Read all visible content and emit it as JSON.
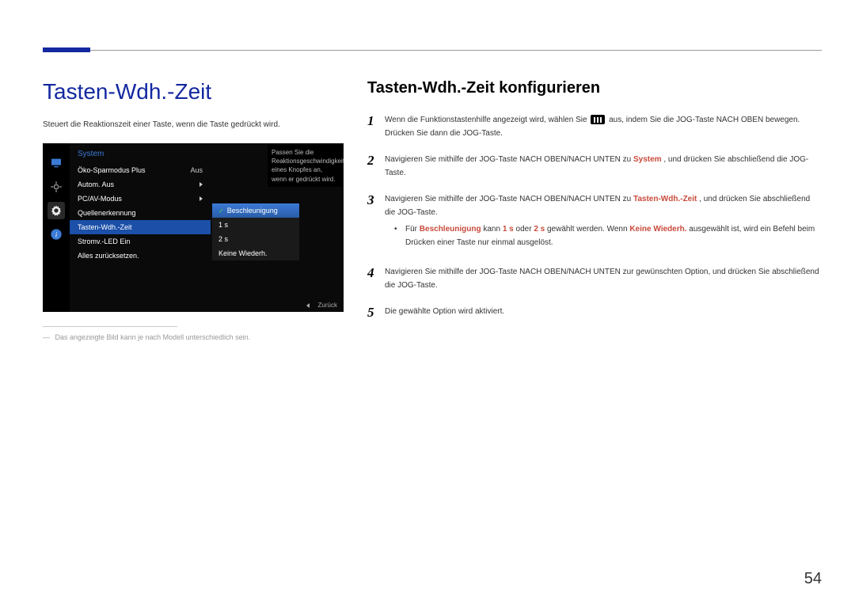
{
  "page_number": "54",
  "main_title": "Tasten-Wdh.-Zeit",
  "description": "Steuert die Reaktionszeit einer Taste, wenn die Taste gedrückt wird.",
  "footnote": "Das angezeigte Bild kann je nach Modell unterschiedlich sein.",
  "osd": {
    "title": "System",
    "tooltip": "Passen Sie die Reaktionsgeschwindigkeit eines Knopfes an, wenn er gedrückt wird.",
    "menu_items": [
      {
        "label": "Öko-Sparmodus Plus",
        "value": "Aus"
      },
      {
        "label": "Autom. Aus",
        "value": "▶"
      },
      {
        "label": "PC/AV-Modus",
        "value": "▶"
      },
      {
        "label": "Quellenerkennung",
        "value": ""
      },
      {
        "label": "Tasten-Wdh.-Zeit",
        "value": ""
      },
      {
        "label": "Stromv.-LED Ein",
        "value": ""
      },
      {
        "label": "Alles zurücksetzen.",
        "value": ""
      }
    ],
    "submenu": [
      {
        "label": "Beschleunigung",
        "checked": true
      },
      {
        "label": "1 s",
        "checked": false
      },
      {
        "label": "2 s",
        "checked": false
      },
      {
        "label": "Keine Wiederh.",
        "checked": false
      }
    ],
    "footer": "Zurück"
  },
  "sub_title": "Tasten-Wdh.-Zeit konfigurieren",
  "steps": {
    "s1a": "Wenn die Funktionstastenhilfe angezeigt wird, wählen Sie ",
    "s1b": " aus, indem Sie die JOG-Taste NACH OBEN bewegen. Drücken Sie dann die JOG-Taste.",
    "s2a": "Navigieren Sie mithilfe der JOG-Taste NACH OBEN/NACH UNTEN zu ",
    "s2h": "System",
    "s2b": ", und drücken Sie abschließend die JOG-Taste.",
    "s3a": "Navigieren Sie mithilfe der JOG-Taste NACH OBEN/NACH UNTEN zu ",
    "s3h": "Tasten-Wdh.-Zeit",
    "s3b": ", und drücken Sie abschließend die JOG-Taste.",
    "bullet_a": "Für ",
    "bullet_h1": "Beschleunigung",
    "bullet_b": " kann ",
    "bullet_h2": "1 s",
    "bullet_c": " oder ",
    "bullet_h3": "2 s",
    "bullet_d": " gewählt werden. Wenn ",
    "bullet_h4": "Keine Wiederh.",
    "bullet_e": " ausgewählt ist, wird ein Befehl beim Drücken einer Taste nur einmal ausgelöst.",
    "s4": "Navigieren Sie mithilfe der JOG-Taste NACH OBEN/NACH UNTEN zur gewünschten Option, und drücken Sie abschließend die JOG-Taste.",
    "s5": "Die gewählte Option wird aktiviert."
  }
}
